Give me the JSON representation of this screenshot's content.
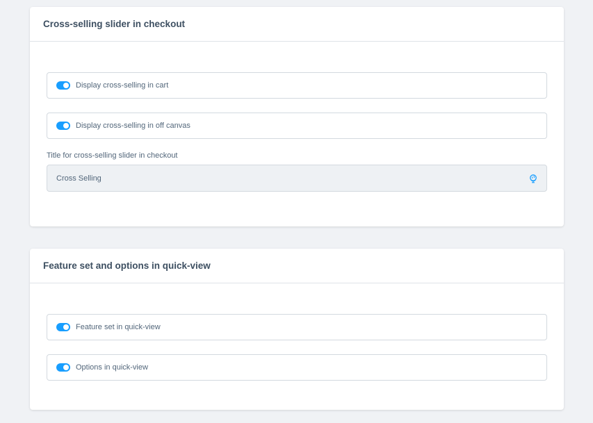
{
  "section_checkout": {
    "title": "Cross-selling slider in checkout",
    "toggles": [
      {
        "label": "Display cross-selling in cart",
        "checked": true
      },
      {
        "label": "Display cross-selling in off canvas",
        "checked": true
      }
    ],
    "title_field": {
      "label": "Title for cross-selling slider in checkout",
      "value": "Cross Selling"
    }
  },
  "section_quickview": {
    "title": "Feature set and options in quick-view",
    "toggles": [
      {
        "label": "Feature set in quick-view",
        "checked": true
      },
      {
        "label": "Options in quick-view",
        "checked": true
      }
    ]
  },
  "colors": {
    "accent": "#189eff",
    "background": "#f0f2f5",
    "card": "#ffffff",
    "text": "#52667a"
  }
}
